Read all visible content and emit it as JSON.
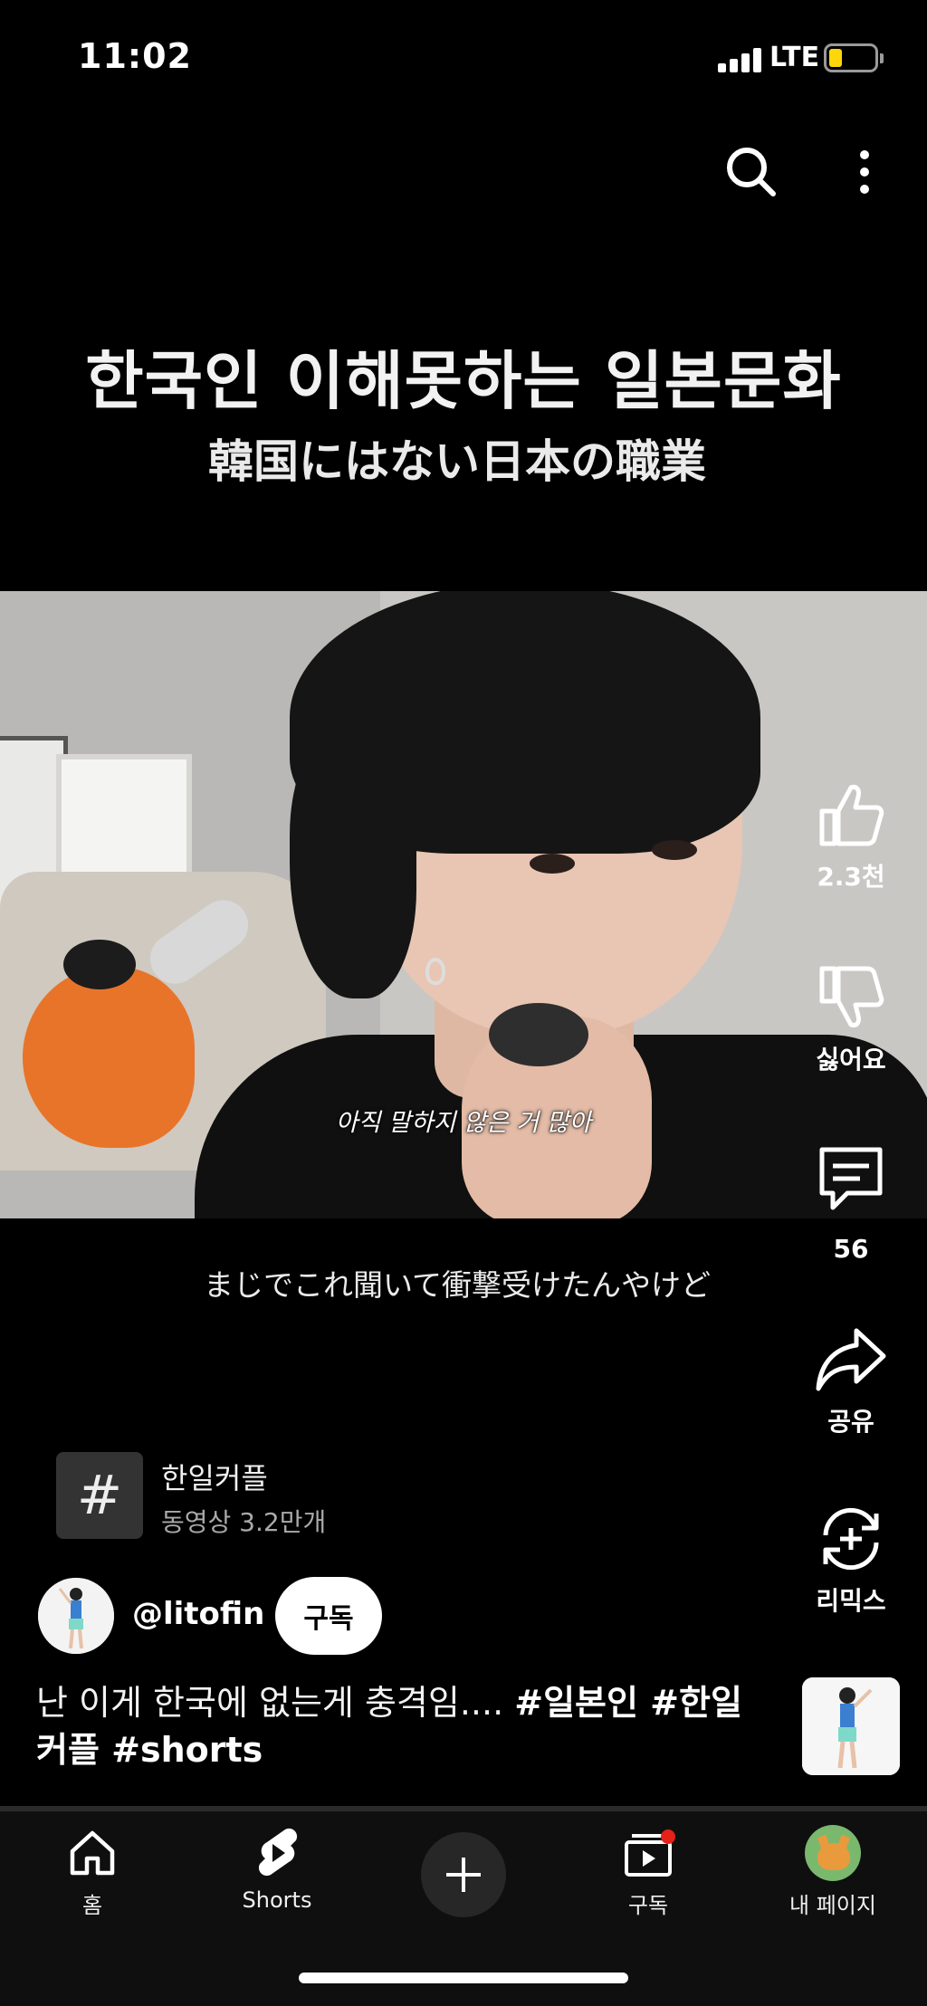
{
  "status_bar": {
    "time": "11:02",
    "network": "LTE",
    "battery_level": 0.2
  },
  "video": {
    "title_korean": "한국인 이해못하는 일본문화",
    "title_japanese": "韓国にはない日本の職業",
    "burned_subtitle": "아직 말하지 않은 거 많아",
    "caption": "まじでこれ聞いて衝撃受けたんやけど"
  },
  "actions": {
    "like_count": "2.3천",
    "dislike_label": "싫어요",
    "comment_count": "56",
    "share_label": "공유",
    "remix_label": "리믹스"
  },
  "hashtag": {
    "symbol": "#",
    "name": "한일커플",
    "video_count": "동영상 3.2만개"
  },
  "channel": {
    "handle": "@litofin",
    "subscribe_label": "구독"
  },
  "description": {
    "text": "난 이게 한국에 없는게 충격임.... ",
    "hashtags_line1": "#일본인 #한일",
    "hashtags_line2": "커플 #shorts"
  },
  "nav": {
    "home": "홈",
    "shorts": "Shorts",
    "subscriptions": "구독",
    "my_page": "내 페이지"
  },
  "colors": {
    "accent_red": "#e62117",
    "battery_yellow": "#ffd60a"
  }
}
